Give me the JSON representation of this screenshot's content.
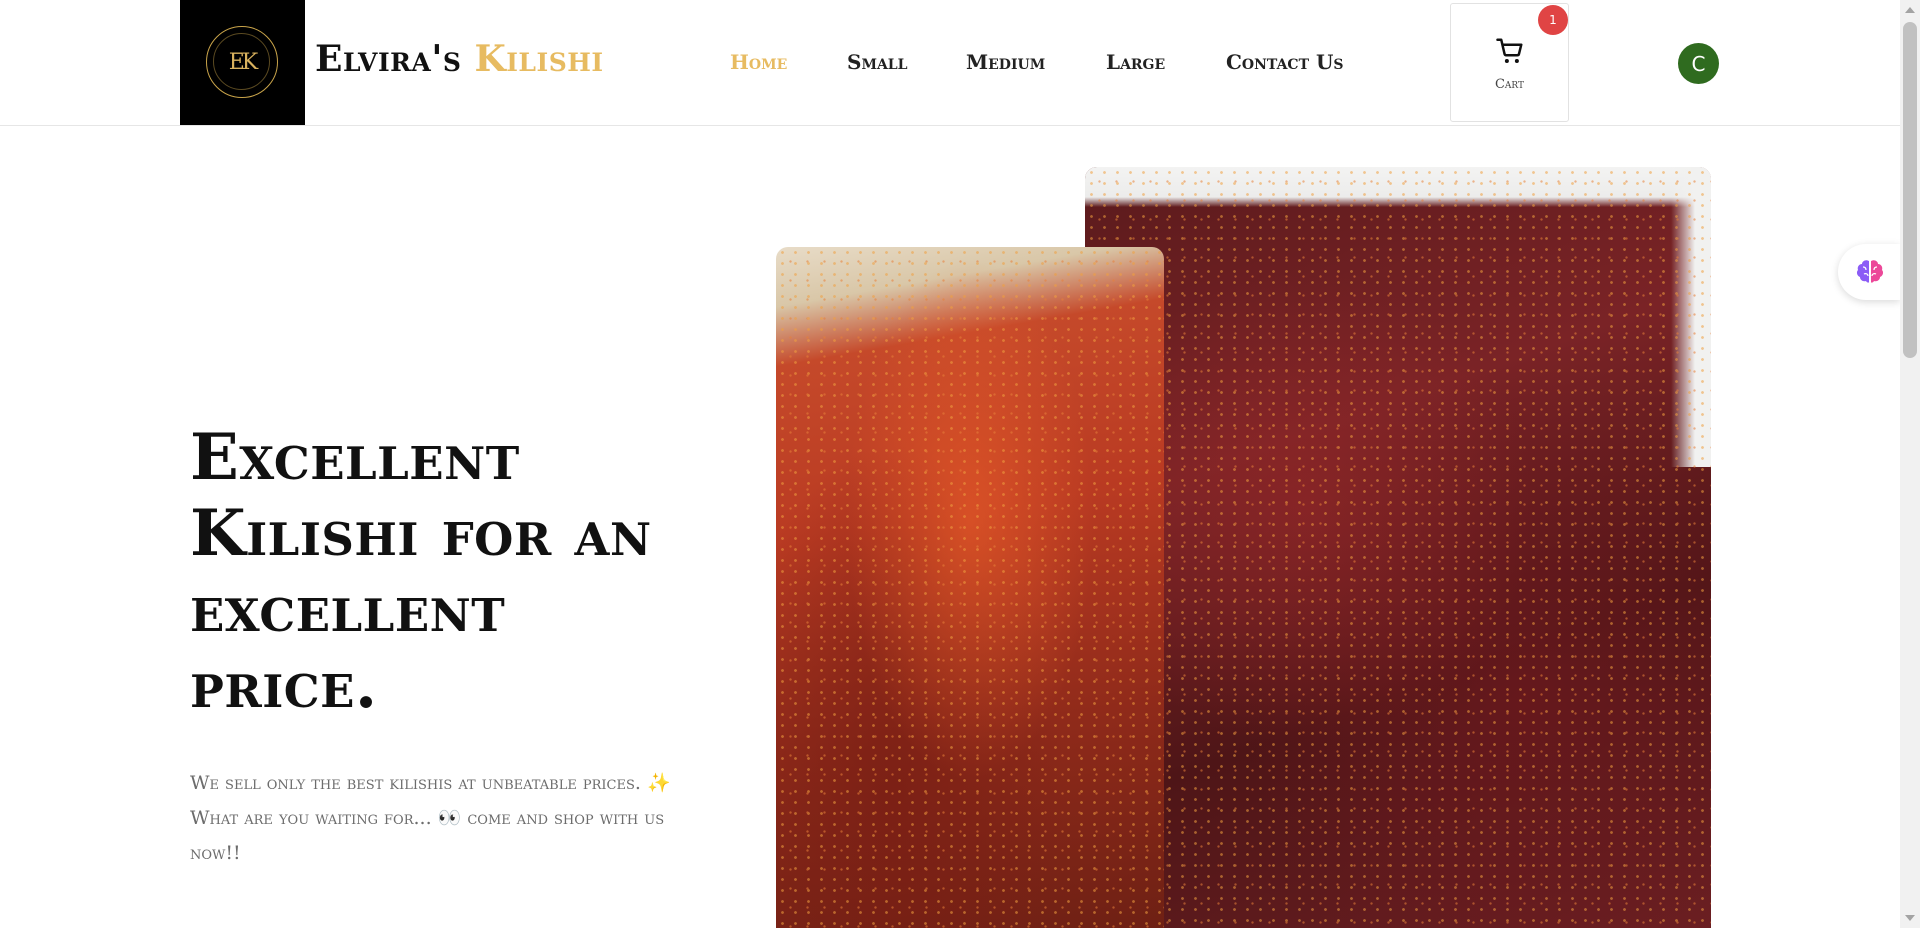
{
  "header": {
    "brand_part1": "Elvira's",
    "brand_part2": "Kilishi",
    "logo_monogram": "EK",
    "nav": [
      {
        "label": "Home",
        "active": true
      },
      {
        "label": "Small",
        "active": false
      },
      {
        "label": "Medium",
        "active": false
      },
      {
        "label": "Large",
        "active": false
      },
      {
        "label": "Contact Us",
        "active": false
      }
    ],
    "cart_label": "Cart",
    "cart_count": "1",
    "avatar_initial": "C"
  },
  "hero": {
    "title": "Excellent Kilishi for an excellent price.",
    "sub_line1": "We sell only the best kilishis at unbeatable prices. ✨",
    "sub_line2": "What are you waiting for... 👀 come and shop with us now!!"
  },
  "colors": {
    "accent": "#e7bb61",
    "badge": "#e04444",
    "avatar_bg": "#2f6b1f"
  },
  "icons": [
    "logo-emblem",
    "cart-icon",
    "brain-icon"
  ]
}
